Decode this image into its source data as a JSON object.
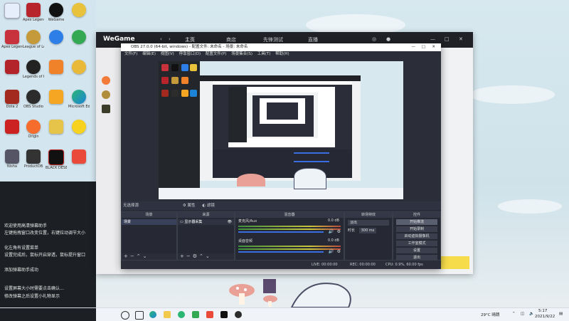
{
  "desktop": {
    "icons_col1": [
      "",
      "Apex Legends",
      "",
      "Dota 2",
      "",
      "Nisha",
      "",
      "PRO MAX"
    ],
    "icons_col2": [
      "Apex Legends",
      "League of Legends",
      "Legends of Runeterra",
      "Legends of Runeterra",
      "OBS Studio",
      "Origin",
      "ProductDB",
      ""
    ],
    "icons_col3": [
      "WeGame",
      "",
      "",
      "",
      "",
      "",
      "BLACK DESERT",
      ""
    ],
    "icons_col4": [
      "",
      "",
      "",
      "",
      "Microsoft Edge",
      "",
      "",
      ""
    ],
    "chat_lines": [
      "欢迎使用高清弹幕助手",
      "左键拖拽窗口改变位置，右键拉动调节大小",
      "化左角有设置菜单",
      "设置完成后，鼠标开启穿透，鼠标提升窗口",
      "添加弹幕助手成功",
      "设置屏幕大小时需要点击确认…",
      "修改弹幕之后设置小礼物显示"
    ]
  },
  "wegame": {
    "logo": "WeGame",
    "tabs": [
      "主页",
      "商店",
      "先锋测试",
      "直播"
    ]
  },
  "obs": {
    "title": "OBS 27.0.0 (64-bit, windows) - 配置文件: 未命名 - 场景: 未命名",
    "menu": [
      "文件(F)",
      "编辑(E)",
      "视图(V)",
      "停靠窗口(D)",
      "配置文件(P)",
      "场景集合(S)",
      "工具(T)",
      "帮助(H)"
    ],
    "dock_bar": {
      "label": "无选择源",
      "properties": "属性",
      "filters": "滤镜"
    },
    "scenes": {
      "header": "场景",
      "items": [
        "场景"
      ]
    },
    "sources": {
      "header": "来源",
      "items": [
        "显示器采集"
      ]
    },
    "mixer": {
      "header": "混音器",
      "channels": [
        {
          "name": "麦克风/Aux",
          "db": "0.0 dB"
        },
        {
          "name": "桌面音频",
          "db": "0.0 dB"
        }
      ]
    },
    "transitions": {
      "header": "转场特效",
      "type": "淡出",
      "duration_label": "时长",
      "duration": "300 ms"
    },
    "controls": {
      "header": "控件",
      "buttons": [
        "开始推流",
        "开始录制",
        "启动虚拟摄像机",
        "工作室模式",
        "设置",
        "退出"
      ]
    },
    "status": {
      "live": "LIVE: 00:00:00",
      "rec": "REC: 00:00:00",
      "cpu": "CPU: 0.9%, 60.00 fps"
    }
  },
  "taskbar": {
    "weather": "29°C 晴朗",
    "time": "5:17",
    "date": "2021/9/22"
  }
}
